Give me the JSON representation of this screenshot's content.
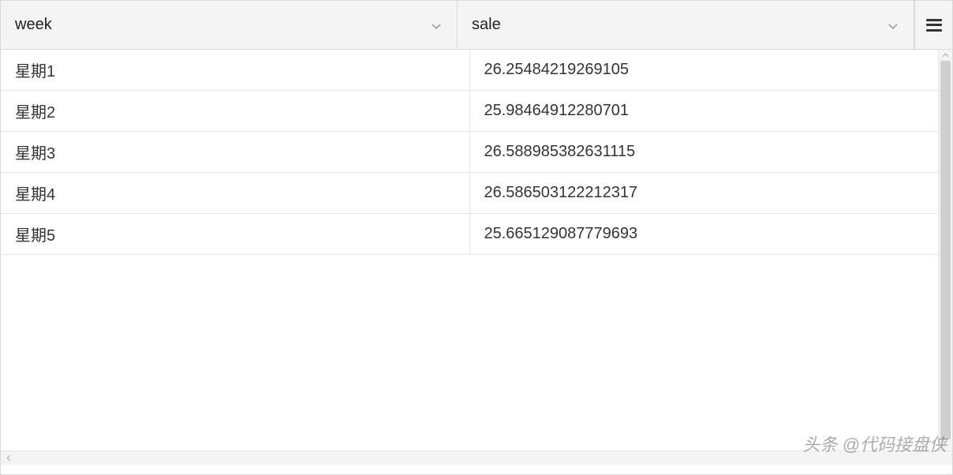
{
  "columns": [
    {
      "key": "week",
      "label": "week"
    },
    {
      "key": "sale",
      "label": "sale"
    }
  ],
  "rows": [
    {
      "week": "星期1",
      "sale": "26.25484219269105"
    },
    {
      "week": "星期2",
      "sale": "25.98464912280701"
    },
    {
      "week": "星期3",
      "sale": "26.588985382631115"
    },
    {
      "week": "星期4",
      "sale": "26.586503122212317"
    },
    {
      "week": "星期5",
      "sale": "25.665129087779693"
    }
  ],
  "watermark": "头条 @代码接盘侠",
  "chart_data": {
    "type": "table",
    "columns": [
      "week",
      "sale"
    ],
    "rows": [
      [
        "星期1",
        26.25484219269105
      ],
      [
        "星期2",
        25.98464912280701
      ],
      [
        "星期3",
        26.588985382631115
      ],
      [
        "星期4",
        26.586503122212317
      ],
      [
        "星期5",
        25.665129087779693
      ]
    ]
  }
}
